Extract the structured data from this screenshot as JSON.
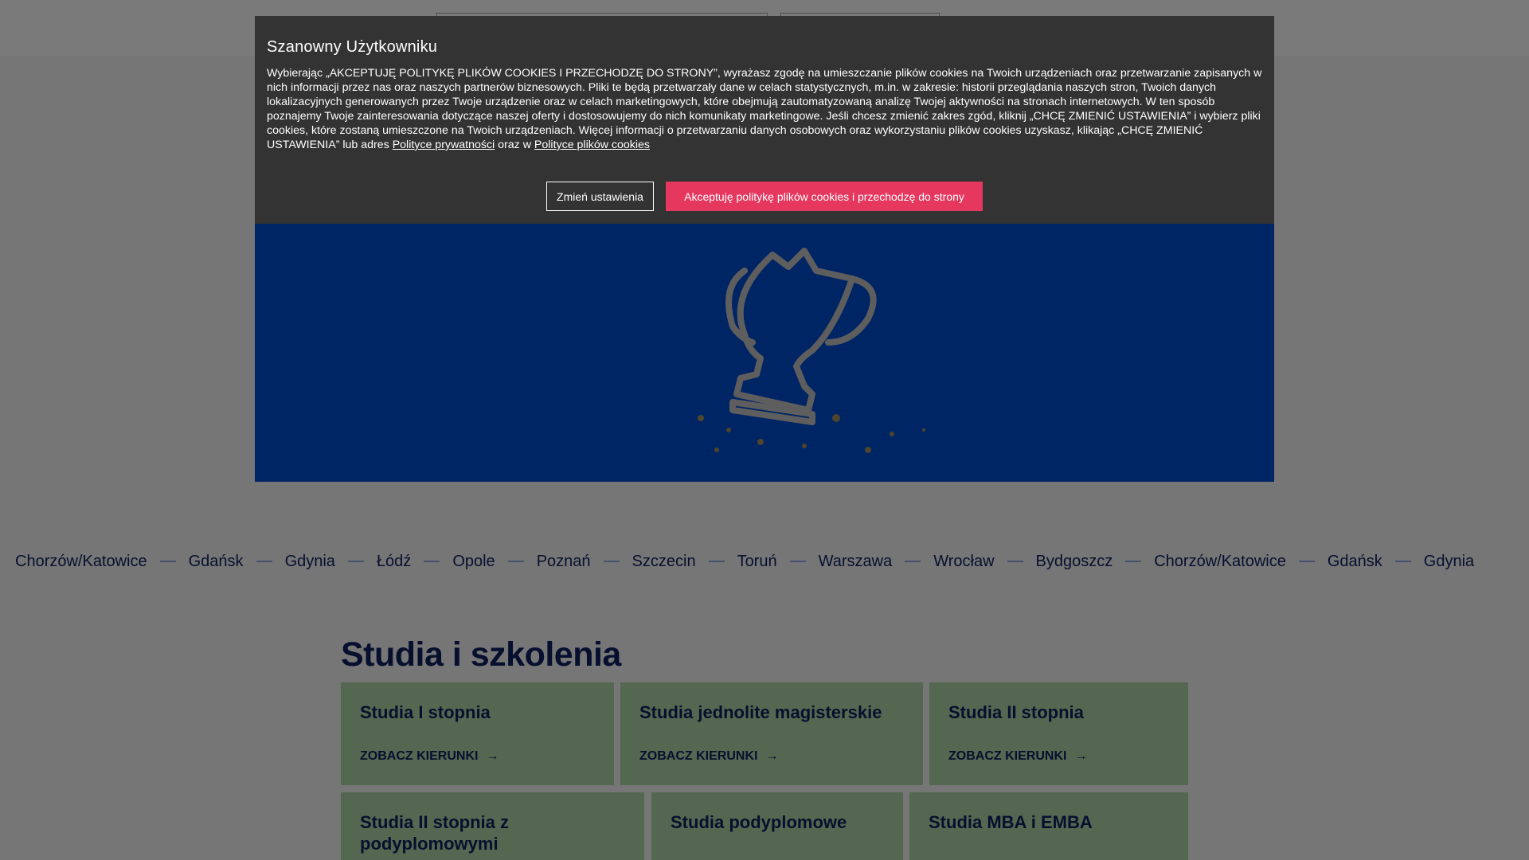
{
  "cookie_banner": {
    "title": "Szanowny Użytkowniku",
    "body": "Wybierając „AKCEPTUJĘ POLITYKĘ PLIKÓW COOKIES I PRZECHODZĘ DO STRONY”, wyrażasz zgodę na umieszczanie plików cookies na Twoich urządzeniach oraz przetwarzanie zapisanych w nich informacji przez nas oraz naszych partnerów biznesowych. Pliki te będą przetwarzały dane w celach statystycznych, m.in. w zakresie: historii przeglądania naszych stron, Twoich danych lokalizacyjnych generowanych przez Twoje urządzenie oraz w celach marketingowych, które obejmują zautomatyzowaną analizę Twojej aktywności na stronach internetowych. W ten sposób poznajemy Twoje zainteresowania dotyczące naszej oferty i dostosowujemy do nich komunikaty marketingowe. Jeśli chcesz zmienić zakres zgód, kliknij „CHCĘ ZMIENIĆ USTAWIENIA” i wybierz pliki cookies, które zostaną umieszczone na Twoich urządzeniach. Więcej informacji o przetwarzaniu danych osobowych oraz wykorzystaniu plików cookies uzyskasz, klikając „CHCĘ ZMIENIĆ USTAWIENIA” lub adres",
    "privacy_link": "Polityce prywatności",
    "connector": "oraz w",
    "cookies_link": "Polityce plików cookies",
    "change_settings_label": "Zmień ustawienia",
    "accept_label": "Akceptuję politykę plików cookies i przechodzę do strony",
    "accent_color": "#e6375e"
  },
  "hero": {
    "background_color": "#004bc8",
    "icon": "trophy-icon"
  },
  "cities": [
    "Chorzów/Katowice",
    "Gdańsk",
    "Gdynia",
    "Łódź",
    "Opole",
    "Poznań",
    "Szczecin",
    "Toruń",
    "Warszawa",
    "Wrocław",
    "Bydgoszcz",
    "Chorzów/Katowice",
    "Gdańsk",
    "Gdynia"
  ],
  "studies": {
    "section_title": "Studia i szkolenia",
    "cards": [
      {
        "title": "Studia I stopnia",
        "link": "ZOBACZ KIERUNKI"
      },
      {
        "title": "Studia jednolite magisterskie",
        "link": "ZOBACZ KIERUNKI"
      },
      {
        "title": "Studia II stopnia",
        "link": "ZOBACZ KIERUNKI"
      },
      {
        "title": "Studia II stopnia z podyplomowymi",
        "link": ""
      },
      {
        "title": "Studia podyplomowe",
        "link": ""
      },
      {
        "title": "Studia MBA i EMBA",
        "link": ""
      }
    ],
    "card_color": "#a9cfa0"
  }
}
